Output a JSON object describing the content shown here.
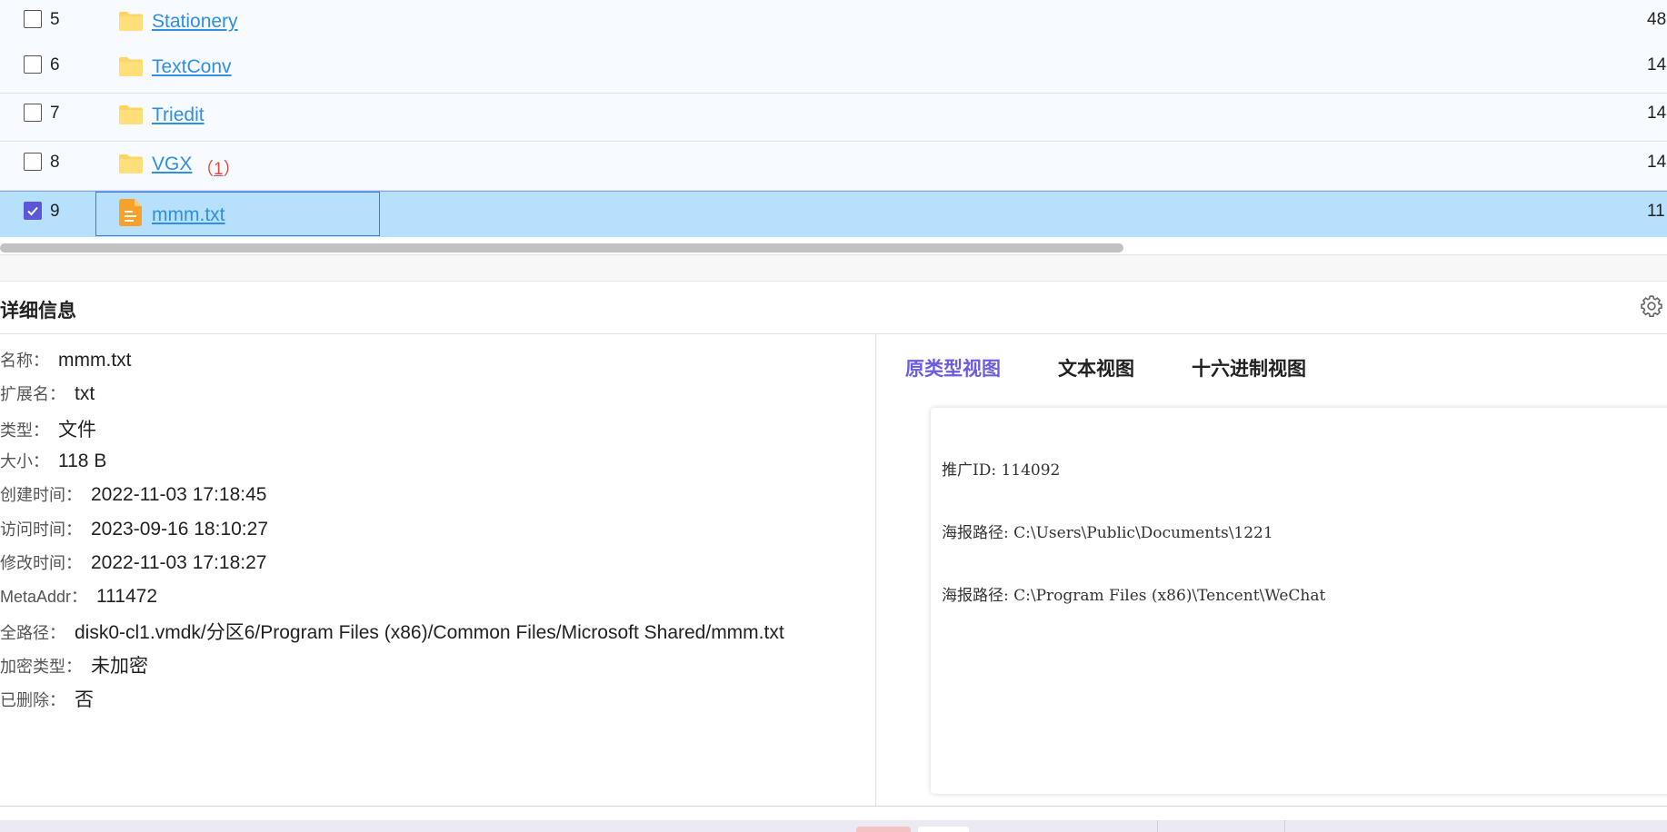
{
  "file_table": {
    "rows": [
      {
        "index": "5",
        "name": "Stationery",
        "size": "48",
        "count": "",
        "type": "folder",
        "checked": false
      },
      {
        "index": "6",
        "name": "TextConv",
        "size": "14",
        "count": "",
        "type": "folder",
        "checked": false
      },
      {
        "index": "7",
        "name": "Triedit",
        "size": "14",
        "count": "",
        "type": "folder",
        "checked": false
      },
      {
        "index": "8",
        "name": "VGX",
        "size": "14",
        "count": "1",
        "type": "folder",
        "checked": false
      },
      {
        "index": "9",
        "name": "mmm.txt",
        "size": "11",
        "count": "",
        "type": "text-file",
        "checked": true
      }
    ]
  },
  "details": {
    "title": "详细信息",
    "fields": [
      {
        "label": "名称：",
        "value": "mmm.txt"
      },
      {
        "label": "扩展名：",
        "value": "txt"
      },
      {
        "label": "类型：",
        "value": "文件"
      },
      {
        "label": "大小：",
        "value": "118 B"
      },
      {
        "label": "创建时间：",
        "value": "2022-11-03 17:18:45"
      },
      {
        "label": "访问时间：",
        "value": "2023-09-16 18:10:27"
      },
      {
        "label": "修改时间：",
        "value": "2022-11-03 17:18:27"
      },
      {
        "label": "MetaAddr：",
        "value": "111472"
      },
      {
        "label": "全路径：",
        "value": "disk0-cl1.vmdk/分区6/Program Files (x86)/Common Files/Microsoft Shared/mmm.txt"
      },
      {
        "label": "加密类型：",
        "value": "未加密"
      },
      {
        "label": "已删除：",
        "value": "否"
      }
    ]
  },
  "preview": {
    "tabs": [
      {
        "label": "原类型视图",
        "active": true
      },
      {
        "label": "文本视图",
        "active": false
      },
      {
        "label": "十六进制视图",
        "active": false
      }
    ],
    "content_lines": [
      "推广ID: 114092",
      "海报路径: C:\\Users\\Public\\Documents\\1221",
      "海报路径: C:\\Program Files (x86)\\Tencent\\WeChat"
    ]
  },
  "colors": {
    "link": "#2f8fe0",
    "selected_row": "#b6e0fb",
    "active_tab": "#6b5de0",
    "checkbox_checked": "#5b57d6",
    "folder": "#ffd561",
    "count_red": "#e04848"
  },
  "icons": {
    "folder": "folder-icon",
    "file": "text-file-icon",
    "settings": "gear-icon",
    "check": "checkmark-icon"
  }
}
